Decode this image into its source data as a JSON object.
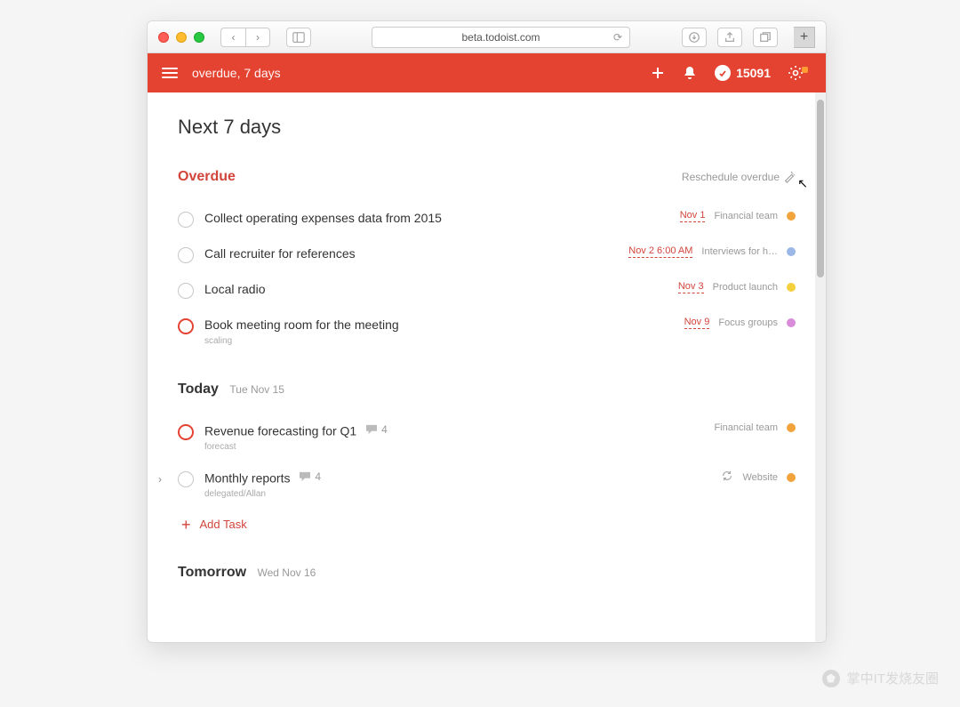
{
  "browser": {
    "url": "beta.todoist.com"
  },
  "header": {
    "breadcrumb": "overdue, 7 days",
    "karma_points": "15091"
  },
  "page": {
    "title": "Next 7 days"
  },
  "sections": {
    "overdue": {
      "title": "Overdue",
      "reschedule_label": "Reschedule overdue",
      "tasks": [
        {
          "title": "Collect operating expenses data from 2015",
          "date": "Nov 1",
          "project": "Financial team",
          "color": "#f2a33c"
        },
        {
          "title": "Call recruiter for references",
          "date": "Nov 2 6:00 AM",
          "project": "Interviews for h…",
          "color": "#9bb7e8"
        },
        {
          "title": "Local radio",
          "date": "Nov 3",
          "project": "Product launch",
          "color": "#f4d03f"
        },
        {
          "title": "Book meeting room for the meeting",
          "sub": "scaling",
          "date": "Nov 9",
          "project": "Focus groups",
          "color": "#d98cd9",
          "priority": true
        }
      ]
    },
    "today": {
      "title": "Today",
      "sub": "Tue Nov 15",
      "tasks": [
        {
          "title": "Revenue forecasting for Q1",
          "sub": "forecast",
          "comments": "4",
          "project": "Financial team",
          "color": "#f2a33c",
          "priority": true
        },
        {
          "title": "Monthly reports",
          "sub": "delegated/Allan",
          "comments": "4",
          "project": "Website",
          "color": "#f2a33c",
          "recurring": true,
          "expandable": true
        }
      ],
      "add_task_label": "Add Task"
    },
    "tomorrow": {
      "title": "Tomorrow",
      "sub": "Wed Nov 16"
    }
  },
  "watermark": "掌中IT发烧友圈"
}
